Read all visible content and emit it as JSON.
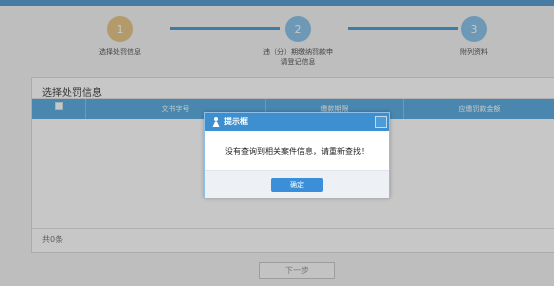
{
  "colors": {
    "accent": "#4e9fd6",
    "step1": "#e6c689",
    "step_blue": "#8cc4ea",
    "dialog_header": "#3d8fd0"
  },
  "steps": [
    {
      "number": "1",
      "label_line1": "选择处罚信息",
      "label_line2": ""
    },
    {
      "number": "2",
      "label_line1": "违（分）期缴纳罚款申",
      "label_line2": "请登记信息"
    },
    {
      "number": "3",
      "label_line1": "附列资料",
      "label_line2": ""
    }
  ],
  "panel": {
    "title": "选择处罚信息",
    "columns": [
      "文书字号",
      "缴款期限",
      "应缴罚款金额"
    ],
    "footer": "共0条"
  },
  "next_button": "下一步",
  "dialog": {
    "title": "提示框",
    "message": "没有查询到相关案件信息，请重新查找！",
    "ok_label": "确定"
  }
}
